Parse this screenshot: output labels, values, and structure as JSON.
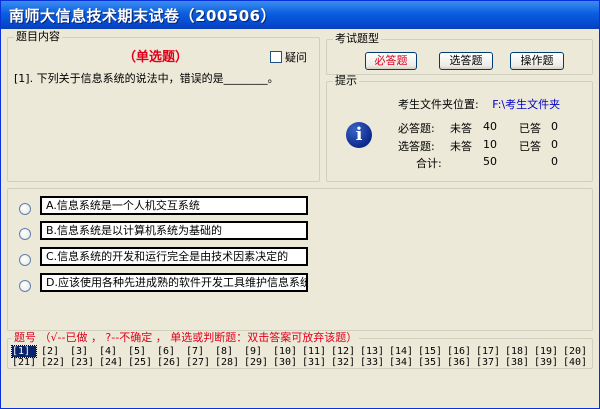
{
  "window": {
    "title": "南师大信息技术期末试卷（200506）"
  },
  "question_panel": {
    "legend": "题目内容",
    "type_label": "（单选题）",
    "doubt_label": "疑问",
    "question_text": "[1]. 下列关于信息系统的说法中，错误的是________。"
  },
  "type_panel": {
    "legend": "考试题型",
    "buttons": [
      "必答题",
      "选答题",
      "操作题"
    ]
  },
  "hint_panel": {
    "legend": "提示",
    "folder_label": "考生文件夹位置:",
    "folder_path": "F:\\考生文件夹",
    "rows": [
      {
        "label": "必答题:",
        "unanswered_label": "未答",
        "unanswered": "40",
        "answered_label": "已答",
        "answered": "0"
      },
      {
        "label": "选答题:",
        "unanswered_label": "未答",
        "unanswered": "10",
        "answered_label": "已答",
        "answered": "0"
      }
    ],
    "total_label": "合计:",
    "total_unanswered": "50",
    "total_answered": "0"
  },
  "options": [
    "A.信息系统是一个人机交互系统",
    "B.信息系统是以计算机系统为基础的",
    "C.信息系统的开发和运行完全是由技术因素决定的",
    "D.应该使用各种先进成熟的软件开发工具维护信息系统"
  ],
  "nav_panel": {
    "legend": "题号 （√--已做 ， ?--不确定 ， 单选或判断题：双击答案可放弃该题）",
    "row1": [
      "[1]",
      "[2]",
      "[3]",
      "[4]",
      "[5]",
      "[6]",
      "[7]",
      "[8]",
      "[9]",
      "[10]",
      "[11]",
      "[12]",
      "[13]",
      "[14]",
      "[15]",
      "[16]",
      "[17]",
      "[18]",
      "[19]",
      "[20]"
    ],
    "row2": [
      "[21]",
      "[22]",
      "[23]",
      "[24]",
      "[25]",
      "[26]",
      "[27]",
      "[28]",
      "[29]",
      "[30]",
      "[31]",
      "[32]",
      "[33]",
      "[34]",
      "[35]",
      "[36]",
      "[37]",
      "[38]",
      "[39]",
      "[40]"
    ],
    "current": "[1]"
  },
  "colors": {
    "accent_red": "#e0001b",
    "title_blue": "#0a5ee0",
    "path_blue": "#0000c8"
  }
}
